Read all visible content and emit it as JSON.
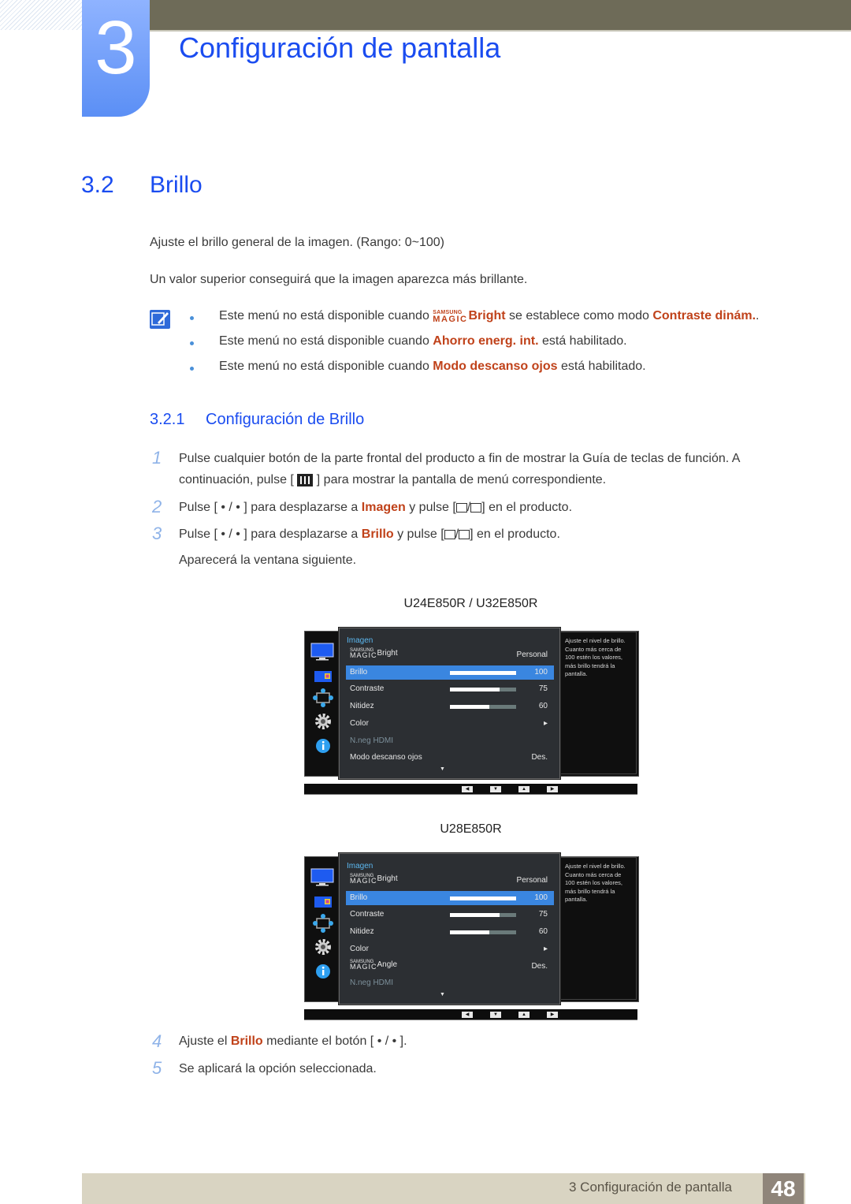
{
  "chapter": {
    "number": "3",
    "title": "Configuración de pantalla"
  },
  "section": {
    "number": "3.2",
    "title": "Brillo"
  },
  "intro": [
    "Ajuste el brillo general de la imagen. (Rango: 0~100)",
    "Un valor superior conseguirá que la imagen aparezca más brillante."
  ],
  "notes": [
    {
      "pre": "Este menú no está disponible cuando ",
      "magic_top": "SAMSUNG",
      "magic_bottom": "MAGIC",
      "highlight1": "Bright",
      "mid": " se establece como modo ",
      "highlight2": "Contraste dinám.",
      "post": "."
    },
    {
      "pre": "Este menú no está disponible cuando ",
      "highlight": "Ahorro energ. int.",
      "post": " está habilitado."
    },
    {
      "pre": "Este menú no está disponible cuando ",
      "highlight": "Modo descanso ojos",
      "post": " está habilitado."
    }
  ],
  "subsection": {
    "number": "3.2.1",
    "title": "Configuración de Brillo"
  },
  "steps": [
    {
      "num": "1",
      "line1": "Pulse cualquier botón de la parte frontal del producto a fin de mostrar la Guía de teclas de función. A",
      "line2_pre": "continuación, pulse [",
      "line2_post": "] para mostrar la pantalla de menú correspondiente."
    },
    {
      "num": "2",
      "pre": "Pulse [ • / • ] para desplazarse a ",
      "highlight": "Imagen",
      "mid": " y pulse [",
      "post": "] en el producto."
    },
    {
      "num": "3",
      "pre": "Pulse [ • / • ] para desplazarse a ",
      "highlight": "Brillo",
      "mid": " y pulse [",
      "post": "] en el producto.",
      "extra": "Aparecerá la ventana siguiente."
    },
    {
      "num": "4",
      "pre": "Ajuste el ",
      "highlight": "Brillo",
      "post": " mediante el botón [ • / • ]."
    },
    {
      "num": "5",
      "text": "Se aplicará la opción seleccionada."
    }
  ],
  "osd_screens": [
    {
      "model": "U24E850R / U32E850R",
      "menu_title": "Imagen",
      "help_text": "Ajuste el nivel de brillo. Cuanto más cerca de 100 estén los valores, más brillo tendrá la pantalla.",
      "rows": [
        {
          "magic_top": "SAMSUNG",
          "magic_bottom": "MAGIC",
          "label": "Bright",
          "value": "Personal"
        },
        {
          "label": "Brillo",
          "value": "100",
          "level": 100,
          "selected": true
        },
        {
          "label": "Contraste",
          "value": "75",
          "level": 75
        },
        {
          "label": "Nitidez",
          "value": "60",
          "level": 60
        },
        {
          "label": "Color",
          "value": "▸"
        },
        {
          "label": "N.neg HDMI",
          "value": "",
          "disabled": true
        },
        {
          "label": "Modo descanso ojos",
          "value": "Des."
        }
      ],
      "nav_buttons": [
        "◀",
        "▼",
        "▲",
        "▶"
      ]
    },
    {
      "model": "U28E850R",
      "menu_title": "Imagen",
      "help_text": "Ajuste el nivel de brillo. Cuanto más cerca de 100 estén los valores, más brillo tendrá la pantalla.",
      "rows": [
        {
          "magic_top": "SAMSUNG",
          "magic_bottom": "MAGIC",
          "label": "Bright",
          "value": "Personal"
        },
        {
          "label": "Brillo",
          "value": "100",
          "level": 100,
          "selected": true
        },
        {
          "label": "Contraste",
          "value": "75",
          "level": 75
        },
        {
          "label": "Nitidez",
          "value": "60",
          "level": 60
        },
        {
          "label": "Color",
          "value": "▸"
        },
        {
          "magic_top": "SAMSUNG",
          "magic_bottom": "MAGIC",
          "label": "Angle",
          "value": "Des."
        },
        {
          "label": "N.neg HDMI",
          "value": "",
          "disabled": true
        }
      ],
      "nav_buttons": [
        "◀",
        "▼",
        "▲",
        "▶"
      ]
    }
  ],
  "footer": {
    "text": "3 Configuración de pantalla",
    "page": "48"
  },
  "colors": {
    "accent_blue": "#1a4cf0",
    "highlight_orange": "#c0421a",
    "osd_selected": "#3a86e0"
  }
}
